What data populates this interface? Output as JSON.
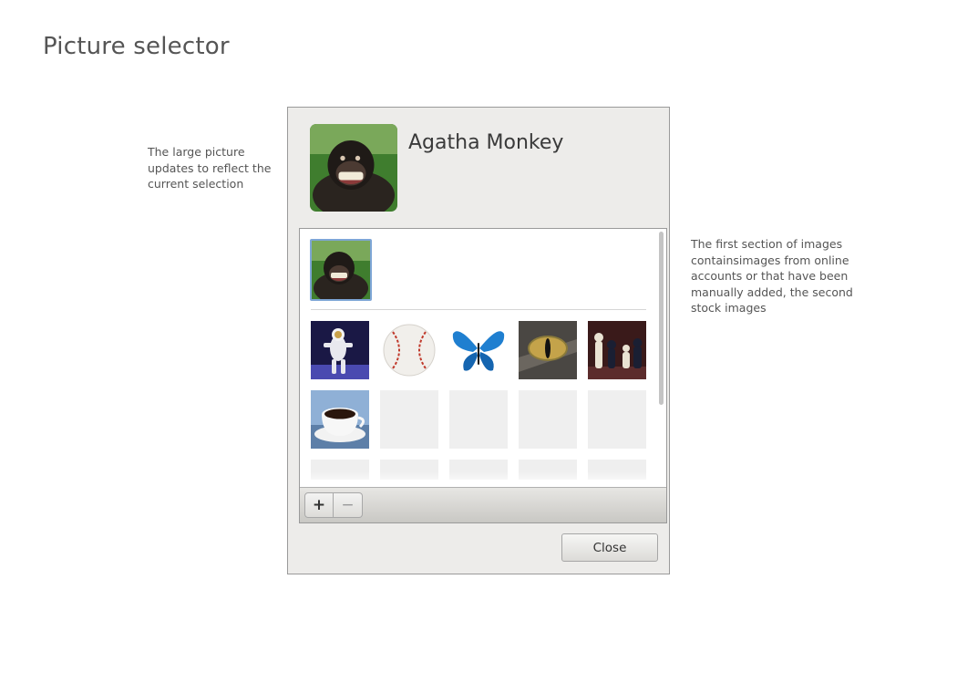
{
  "page": {
    "title": "Picture selector",
    "note_left": "The large picture updates to reflect the current selection",
    "note_right": "The first section of images containsimages from online accounts or that have been manually added, the second stock images"
  },
  "dialog": {
    "user_name": "Agatha Monkey",
    "avatar_icon": "monkey-photo",
    "account_images": [
      {
        "icon": "monkey-photo",
        "selected": true
      }
    ],
    "stock_images": [
      {
        "icon": "astronaut-photo"
      },
      {
        "icon": "baseball-photo"
      },
      {
        "icon": "butterfly-photo"
      },
      {
        "icon": "cat-eye-photo"
      },
      {
        "icon": "chess-photo"
      },
      {
        "icon": "coffee-cup-photo"
      }
    ],
    "toolbar": {
      "add_label": "+",
      "remove_label": "−"
    },
    "close_label": "Close",
    "selection_color": "#7ea6d6"
  }
}
